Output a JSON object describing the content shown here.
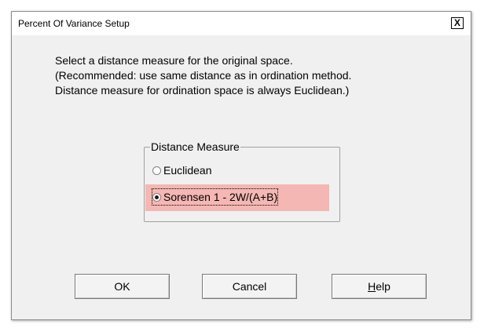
{
  "window": {
    "title": "Percent Of Variance Setup",
    "close_label": "X"
  },
  "description": {
    "line1": "Select a distance measure for the original space.",
    "line2": "(Recommended: use same distance as in ordination method.",
    "line3": "Distance measure for ordination space is always Euclidean.)"
  },
  "distance_measure": {
    "legend": "Distance Measure",
    "options": [
      {
        "label": "Euclidean",
        "selected": false
      },
      {
        "label": "Sorensen 1 - 2W/(A+B)",
        "selected": true
      }
    ]
  },
  "buttons": {
    "ok": "OK",
    "cancel": "Cancel",
    "help_mnemonic": "H",
    "help_rest": "elp"
  },
  "colors": {
    "highlight": "#f4b7b3",
    "dialog_background": "#f0f0f0"
  },
  "icons": {
    "close": "close-icon",
    "radio_unselected": "radio-unselected-icon",
    "radio_selected": "radio-selected-icon"
  }
}
